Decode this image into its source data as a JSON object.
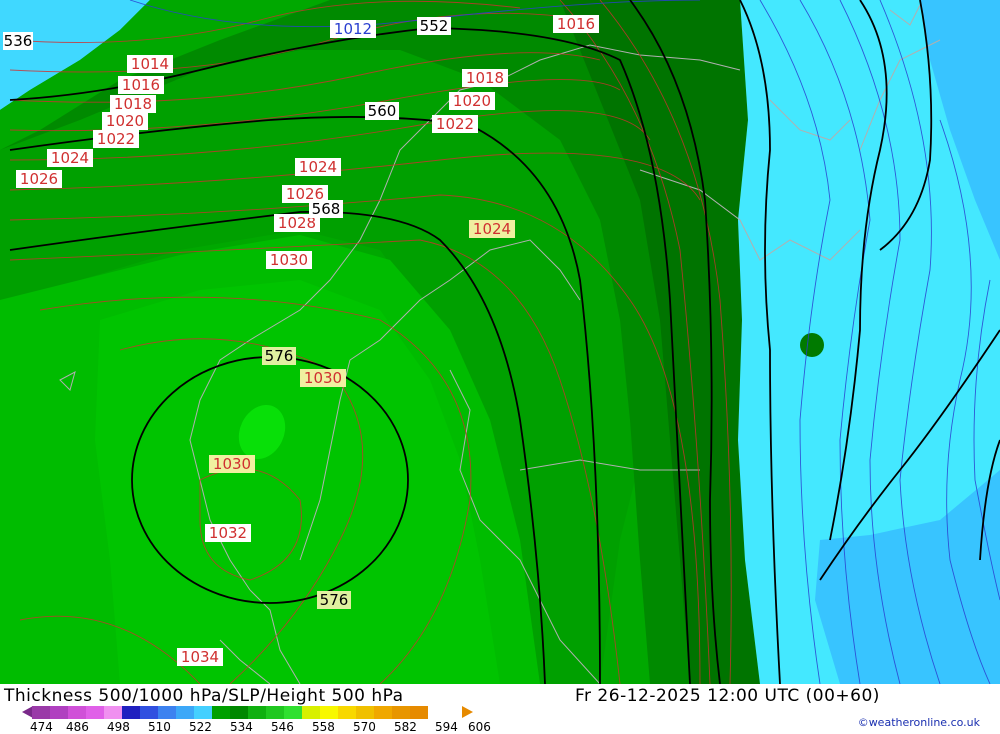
{
  "title": "Thickness 500/1000 hPa/SLP/Height 500 hPa",
  "run_time": "Fr 26-12-2025 12:00 UTC (00+60)",
  "credit": "©weatheronline.co.uk",
  "colorbar": {
    "ticks": [
      "474",
      "486",
      "498",
      "510",
      "522",
      "534",
      "546",
      "558",
      "570",
      "582",
      "594",
      "606"
    ],
    "colors": [
      "#9a3aa8",
      "#b040c0",
      "#d050d8",
      "#e060e8",
      "#f090f0",
      "#2020c0",
      "#3050e0",
      "#3c82f0",
      "#3ca8f8",
      "#44d0ff",
      "#00a000",
      "#008800",
      "#10b010",
      "#20c820",
      "#30e030",
      "#d8f000",
      "#f8f800",
      "#f8d800",
      "#f0c000",
      "#f0a800",
      "#e89600",
      "#e68a00"
    ]
  },
  "slp_labels": [
    "1012",
    "1014",
    "1016",
    "1016",
    "1018",
    "1018",
    "1020",
    "1020",
    "1022",
    "1022",
    "1024",
    "1024",
    "1024",
    "1026",
    "1026",
    "1028",
    "1030",
    "1030",
    "1030",
    "1032",
    "1034"
  ],
  "height_labels": [
    "536",
    "552",
    "560",
    "568",
    "576",
    "576"
  ],
  "accent": {
    "slp_contour": "#d03030",
    "height_contour": "#000000",
    "thickness_dark_green": "#007a00",
    "thickness_green": "#00a800",
    "thickness_light_green": "#00c800",
    "cyan": "#44e8ff",
    "coast": "#b0b0b0"
  }
}
